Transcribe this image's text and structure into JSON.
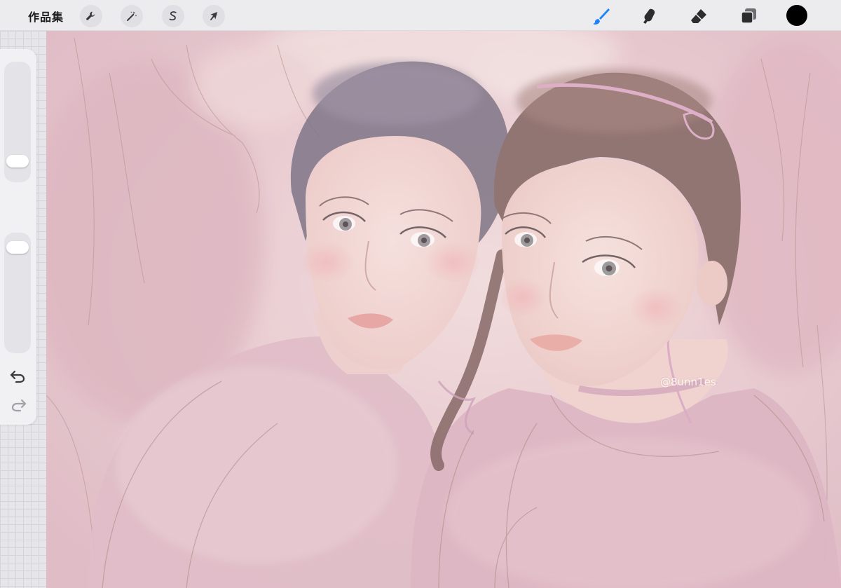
{
  "toolbar": {
    "gallery_label": "作品集",
    "left_tools": [
      {
        "name": "actions",
        "icon": "wrench-icon"
      },
      {
        "name": "adjustments",
        "icon": "magic-wand-icon"
      },
      {
        "name": "selection",
        "icon": "selection-s-icon"
      },
      {
        "name": "transform",
        "icon": "arrow-cursor-icon"
      }
    ],
    "right_tools": [
      {
        "name": "brush",
        "icon": "brush-icon",
        "active": true
      },
      {
        "name": "smudge",
        "icon": "smudge-icon"
      },
      {
        "name": "eraser",
        "icon": "eraser-icon"
      },
      {
        "name": "layers",
        "icon": "layers-icon"
      }
    ],
    "active_color": "#000000",
    "accent_color": "#1a84ff"
  },
  "sidebar": {
    "brush_size_level": 0.12,
    "opacity_level": 0.94,
    "modify_icon": "square-icon",
    "undo_icon": "undo-icon",
    "redo_icon": "redo-icon"
  },
  "canvas": {
    "watermark": "@8unn1es"
  }
}
